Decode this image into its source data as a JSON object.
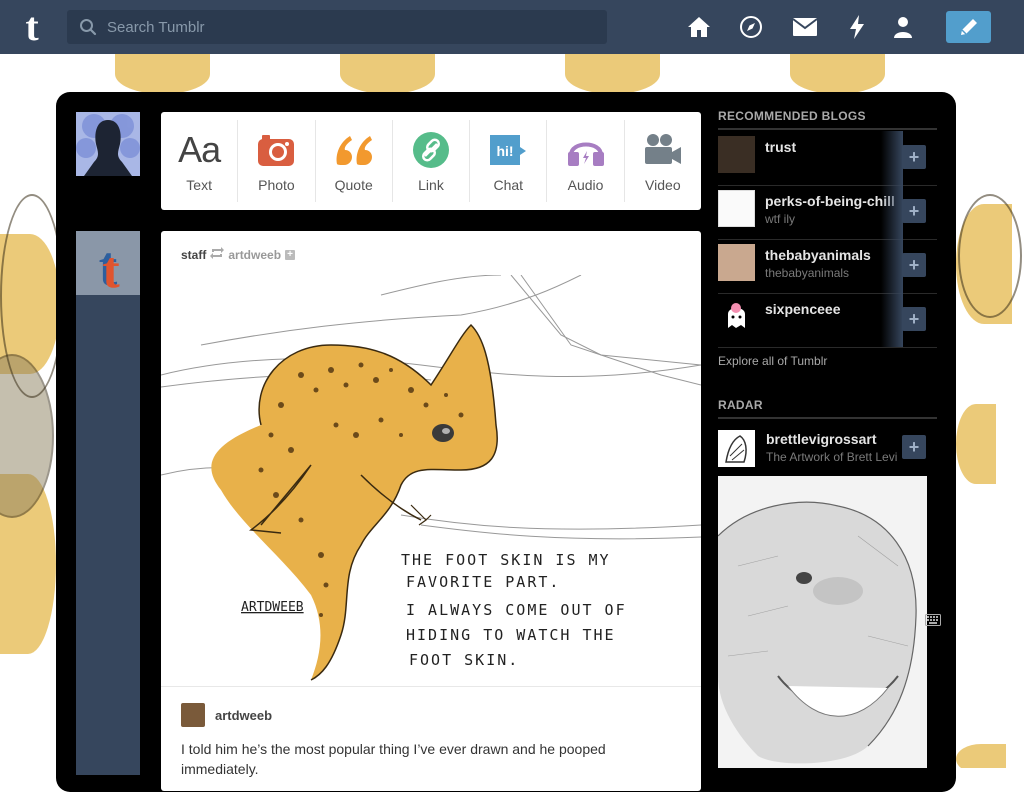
{
  "search": {
    "placeholder": "Search Tumblr"
  },
  "nav": {
    "icons": [
      "home-icon",
      "explore-icon",
      "inbox-icon",
      "activity-icon",
      "account-icon"
    ],
    "compose_icon": "pencil-icon"
  },
  "post_types": [
    {
      "label": "Text",
      "icon": "text-icon",
      "color": "#444444"
    },
    {
      "label": "Photo",
      "icon": "camera-icon",
      "color": "#d95e40"
    },
    {
      "label": "Quote",
      "icon": "quote-icon",
      "color": "#f2992e"
    },
    {
      "label": "Link",
      "icon": "link-icon",
      "color": "#56bc8a"
    },
    {
      "label": "Chat",
      "icon": "chat-icon",
      "color": "#529ecc"
    },
    {
      "label": "Audio",
      "icon": "headphones-icon",
      "color": "#a77dc2"
    },
    {
      "label": "Video",
      "icon": "video-camera-icon",
      "color": "#748089"
    }
  ],
  "post": {
    "blog": "staff",
    "reblogged_from": "artdweeb",
    "author": "artdweeb",
    "art_text": [
      "THE FOOT SKIN IS MY",
      "FAVORITE PART.",
      "I ALWAYS COME OUT OF",
      "HIDING TO WATCH THE",
      "FOOT SKIN."
    ],
    "art_signature": "ARTDWEEB",
    "caption": "I told him he’s the most popular thing I’ve ever drawn and he pooped immediately."
  },
  "sidebar": {
    "recommended_heading": "RECOMMENDED BLOGS",
    "recommended": [
      {
        "name": "trust",
        "sub": ""
      },
      {
        "name": "perks-of-being-chill",
        "sub": "wtf ily"
      },
      {
        "name": "thebabyanimals",
        "sub": "thebabyanimals"
      },
      {
        "name": "sixpenceee",
        "sub": ""
      }
    ],
    "explore_link": "Explore all of Tumblr",
    "radar_heading": "RADAR",
    "radar": {
      "name": "brettlevigrossart",
      "sub": "The Artwork of Brett Levi"
    }
  },
  "colors": {
    "topbar": "#36465d",
    "compose": "#529ecc",
    "dashboard": "#000000",
    "background_pattern": "#e9c46a"
  }
}
